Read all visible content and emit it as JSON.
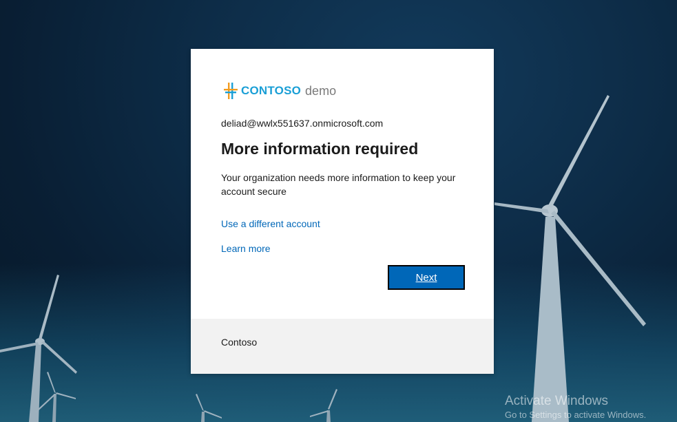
{
  "background": {
    "scene": "wind-turbines-at-dusk",
    "sky_color": "#0d2c47"
  },
  "card": {
    "logo": {
      "brand": "CONTOSO",
      "suffix": "demo",
      "icon": "contoso-logo-icon",
      "brand_color": "#1a9fd6"
    },
    "account_email": "deliad@wwlx551637.onmicrosoft.com",
    "title": "More information required",
    "description": "Your organization needs more information to keep your account secure",
    "links": {
      "different_account": "Use a different account",
      "learn_more": "Learn more"
    },
    "next_button": "Next",
    "footer": "Contoso"
  },
  "watermark": {
    "title": "Activate Windows",
    "subtitle": "Go to Settings to activate Windows."
  },
  "colors": {
    "accent": "#0067b8",
    "footer_bg": "#f2f2f2"
  }
}
